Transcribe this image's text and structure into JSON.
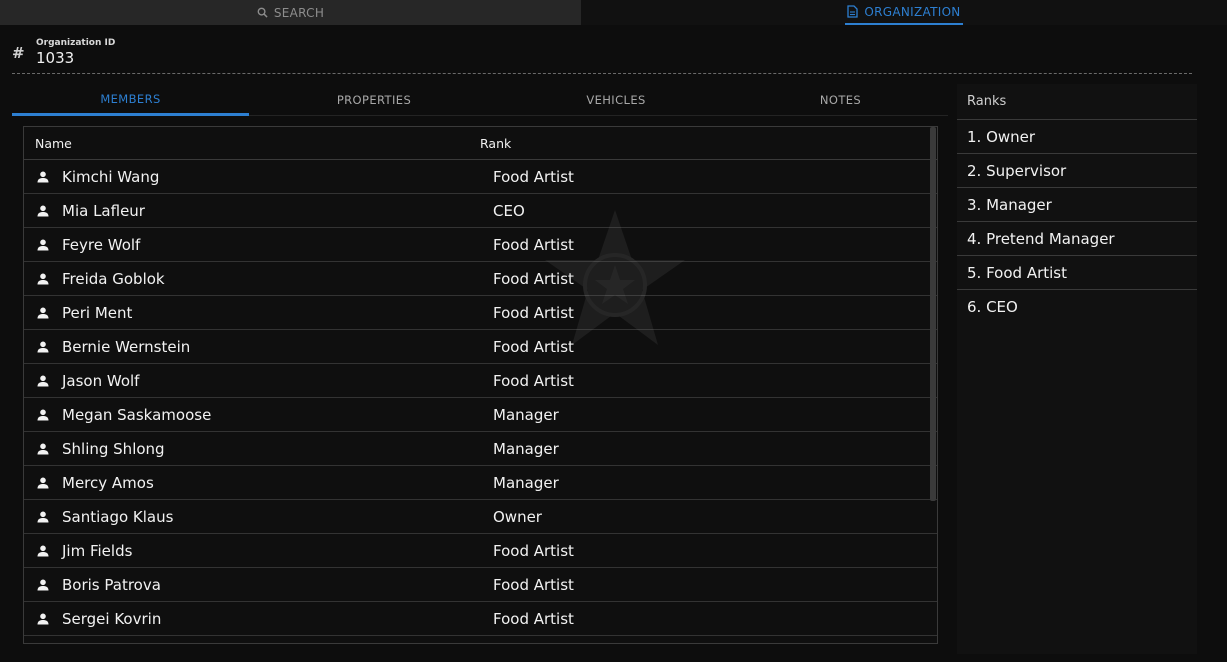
{
  "top_tabs": {
    "search": {
      "label": "SEARCH",
      "icon": "search-icon"
    },
    "organization": {
      "label": "ORGANIZATION",
      "icon": "document-icon"
    }
  },
  "org": {
    "id_label": "Organization ID",
    "id_value": "1033",
    "icon": "hash-icon"
  },
  "sub_tabs": [
    "MEMBERS",
    "PROPERTIES",
    "VEHICLES",
    "NOTES"
  ],
  "members": {
    "columns": {
      "name": "Name",
      "rank": "Rank"
    },
    "rows": [
      {
        "name": "Kimchi Wang",
        "rank": "Food Artist"
      },
      {
        "name": "Mia Lafleur",
        "rank": "CEO"
      },
      {
        "name": "Feyre Wolf",
        "rank": "Food Artist"
      },
      {
        "name": "Freida Goblok",
        "rank": "Food Artist"
      },
      {
        "name": "Peri Ment",
        "rank": "Food Artist"
      },
      {
        "name": "Bernie Wernstein",
        "rank": "Food Artist"
      },
      {
        "name": "Jason Wolf",
        "rank": "Food Artist"
      },
      {
        "name": "Megan Saskamoose",
        "rank": "Manager"
      },
      {
        "name": "Shling Shlong",
        "rank": "Manager"
      },
      {
        "name": "Mercy Amos",
        "rank": "Manager"
      },
      {
        "name": "Santiago Klaus",
        "rank": "Owner"
      },
      {
        "name": "Jim Fields",
        "rank": "Food Artist"
      },
      {
        "name": "Boris Patrova",
        "rank": "Food Artist"
      },
      {
        "name": "Sergei Kovrin",
        "rank": "Food Artist"
      }
    ]
  },
  "ranks": {
    "title": "Ranks",
    "items": [
      "1. Owner",
      "2. Supervisor",
      "3. Manager",
      "4. Pretend Manager",
      "5. Food Artist",
      "6. CEO"
    ]
  },
  "colors": {
    "accent": "#2d7fd1",
    "background": "#0d0d0d"
  }
}
